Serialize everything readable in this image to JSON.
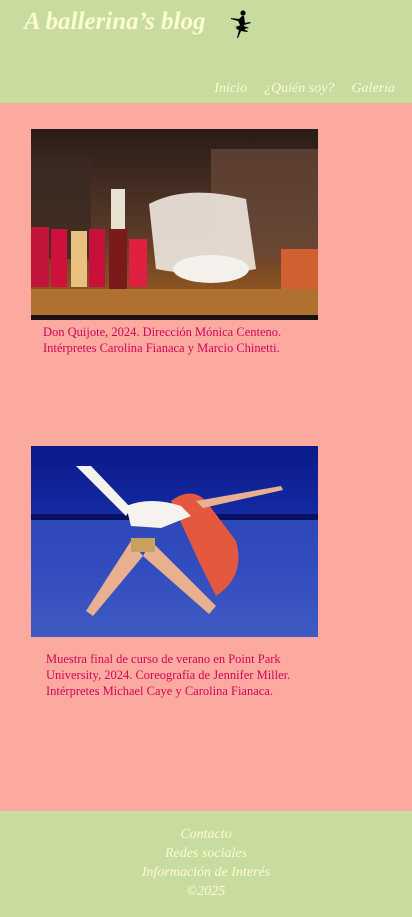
{
  "header": {
    "title": "A ballerina’s blog",
    "icon": "ballerina-silhouette-icon",
    "nav": [
      {
        "label": "Inicio"
      },
      {
        "label": "¿Quién soy?"
      },
      {
        "label": "Galería"
      }
    ]
  },
  "posts": [
    {
      "image": "Don Quijote stage performance photo",
      "caption_line1": "Don Quijote, 2024. Dirección Mónica Centeno.",
      "caption_line2": "Intérpretes Carolina Fianaca y Marcio Chinetti."
    },
    {
      "image": "Two dancers on blue stage photo",
      "caption_line1": "Muestra final de curso de verano en Point Park",
      "caption_line2": "University, 2024. Coreografía de Jennifer Miller.",
      "caption_line3": "Intérpretes Michael Caye y Carolina Fianaca."
    }
  ],
  "footer": {
    "links": [
      {
        "label": "Contacto"
      },
      {
        "label": "Redes sociales"
      },
      {
        "label": "Información de Interés"
      }
    ],
    "copyright": "©2025"
  },
  "colors": {
    "header_bg": "#c8dc9f",
    "page_bg": "#fcaaa0",
    "header_text": "#fefcd0",
    "caption_text": "#d2045a"
  }
}
